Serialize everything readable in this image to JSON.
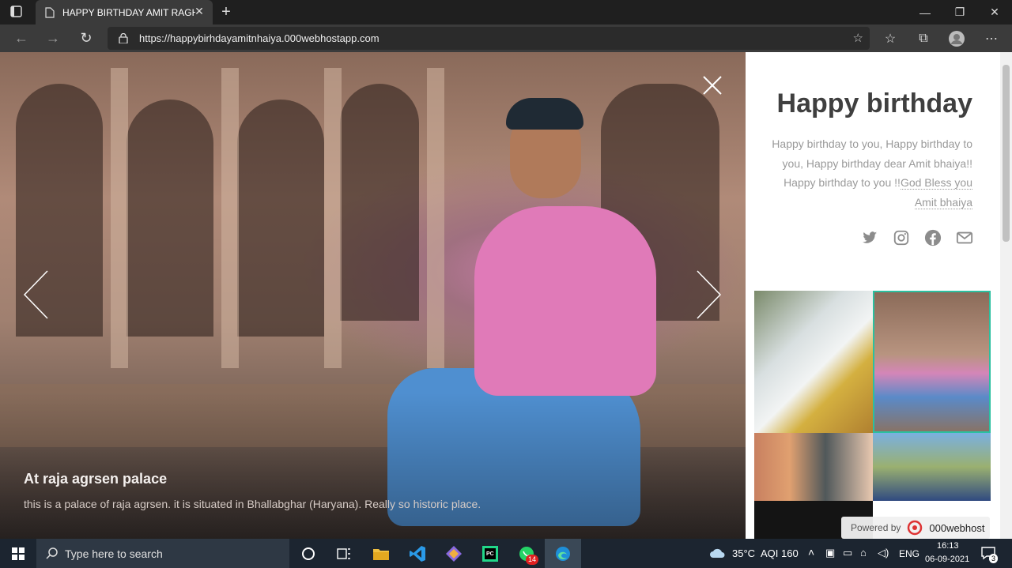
{
  "browser": {
    "tab_title": "HAPPY BIRTHDAY AMIT RAGHAV",
    "url": "https://happybirhdayamitnhaiya.000webhostapp.com"
  },
  "slide": {
    "title": "At raja agrsen palace",
    "description": "this is a palace of raja agrsen. it is situated in Bhallabghar (Haryana). Really so historic place."
  },
  "sidebar": {
    "heading": "Happy birthday",
    "text_plain": "Happy birthday to you, Happy birthday to you, Happy birthday dear Amit bhaiya!! Happy birthday to you !!",
    "text_link": "God Bless you Amit bhaiya",
    "socials": [
      "twitter-icon",
      "instagram-icon",
      "facebook-icon",
      "email-icon"
    ]
  },
  "powered": {
    "prefix": "Powered by",
    "brand": "000webhost"
  },
  "taskbar": {
    "search_placeholder": "Type here to search",
    "weather": "35°C",
    "aqi": "AQI 160",
    "lang": "ENG",
    "time": "16:13",
    "date": "06-09-2021",
    "whatsapp_badge": "14",
    "notification_count": "3"
  },
  "colors": {
    "accent_thumb": "#2bc0a0",
    "browser_bar": "#3b3b3b",
    "taskbar": "#1c2530"
  }
}
